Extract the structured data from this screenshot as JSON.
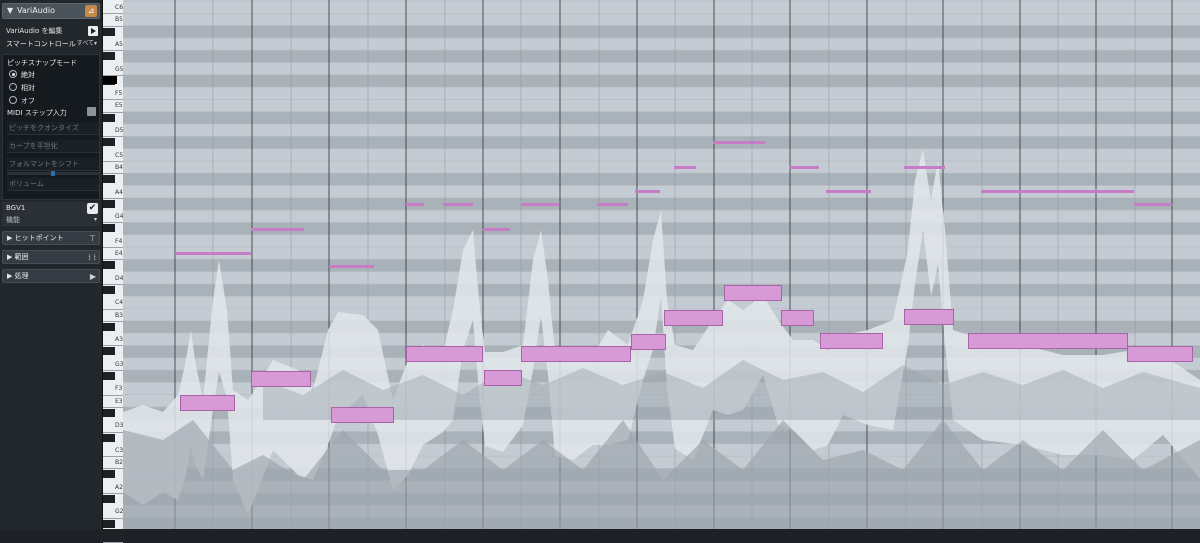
{
  "inspector": {
    "title": "VariAudio",
    "edit_label": "VariAudio を編集",
    "smart_control_label": "スマートコントロール",
    "smart_control_value": "すべて",
    "pitch_snap": {
      "label": "ピッチスナップモード",
      "options": [
        "絶対",
        "相対",
        "オフ"
      ],
      "selected": 0
    },
    "midi_step": "MIDI ステップ入力",
    "pitch_quantize": "ピッチをクオンタイズ",
    "curve_smooth": "カーブを平坦化",
    "formant_shift": "フォルマントをシフト",
    "volume": "ボリューム",
    "track_name": "BGV1",
    "track_sub": "機能",
    "panels": [
      "ヒットポイント",
      "範囲",
      "処理"
    ]
  },
  "keyboard_labels": [
    "C6",
    "B5",
    "A5",
    "G5",
    "F5",
    "E5",
    "D5",
    "C5",
    "B4",
    "A4",
    "G4",
    "F4",
    "E4",
    "D4",
    "C4",
    "B3",
    "A3",
    "G3",
    "F3",
    "E3",
    "D3",
    "C3",
    "B2",
    "A2",
    "G2"
  ],
  "colors": {
    "inspector_bg": "#22272c",
    "grid_light": "#c4cbd2",
    "grid_dark": "#a9b1b9",
    "waveform_light": "#e3e7eb",
    "waveform_dark": "#9ca4ac",
    "note_fill": "#d79ad6",
    "note_border": "#a963a8"
  }
}
